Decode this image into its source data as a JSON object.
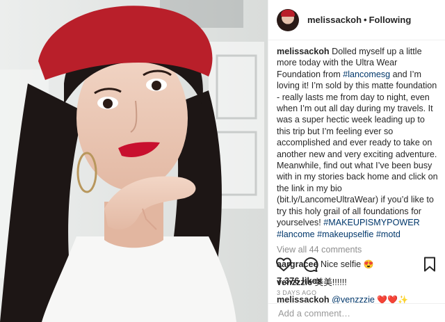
{
  "photo": {
    "alt": "Selfie of a woman in a red beret and white off-shoulder top"
  },
  "header": {
    "username": "melissackoh",
    "separator": "•",
    "follow_status": "Following"
  },
  "caption": {
    "username": "melissackoh",
    "text_1": " Dolled myself up a little more today with the Ultra Wear Foundation from ",
    "tag_1": "#lancomesg",
    "text_2": " and I’m loving it! I’m sold by this matte foundation - really lasts me from day to night, even when I’m out all day during my travels. It was a super hectic week leading up to this trip but I’m feeling ever so accomplished and ever ready to take on another new and very exciting adventure. Meanwhile, find out what I’ve been busy with in my stories back home and click on the link in my bio (bit.ly/LancomeUltraWear) if you’d like to try this holy grail of all foundations for yourselves! ",
    "tag_2": "#MAKEUPISMYPOWER",
    "tag_3": "#lancome",
    "tag_4": "#makeupselfie",
    "tag_5": "#motd"
  },
  "view_all": "View all 44 comments",
  "comments": [
    {
      "username": "aargracee",
      "text": " Nice selfie ",
      "emoji": "😍"
    },
    {
      "username": "venzzzie",
      "text": " 美美!!!!!!"
    },
    {
      "username": "melissackoh",
      "mention": "@venzzzie",
      "emoji": "❤️❤️✨"
    }
  ],
  "likes": "7,376 likes",
  "timestamp": "3 DAYS AGO",
  "add_comment": {
    "placeholder": "Add a comment…"
  },
  "colors": {
    "link": "#00376b",
    "muted": "#8e8e8e",
    "beret": "#b91f2a",
    "lips": "#c8102e"
  },
  "icons": {
    "like": "heart-outline-icon",
    "comment": "comment-bubble-icon",
    "save": "bookmark-icon"
  }
}
